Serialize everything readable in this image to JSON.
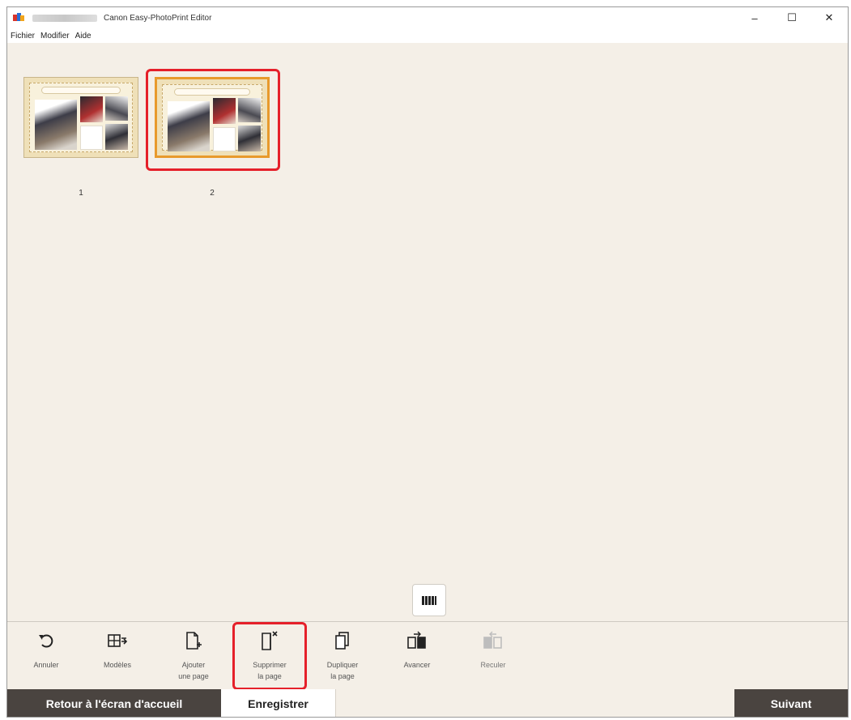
{
  "window": {
    "title": "Canon Easy-PhotoPrint Editor",
    "controls": {
      "minimize": "–",
      "maximize": "☐",
      "close": "✕"
    }
  },
  "menu": [
    {
      "label": "Fichier"
    },
    {
      "label": "Modifier"
    },
    {
      "label": "Aide"
    }
  ],
  "pages": [
    {
      "number": "1",
      "selected": false
    },
    {
      "number": "2",
      "selected": true
    }
  ],
  "toolbar": {
    "undo": {
      "label": "Annuler",
      "icon": "undo-icon"
    },
    "templates": {
      "label": "Modèles",
      "icon": "templates-icon"
    },
    "add_page": {
      "label": "Ajouter\nune page",
      "icon": "add-page-icon"
    },
    "delete_page": {
      "label": "Supprimer\nla page",
      "icon": "delete-page-icon"
    },
    "duplicate_page": {
      "label": "Dupliquer\nla page",
      "icon": "duplicate-page-icon"
    },
    "move_forward": {
      "label": "Avancer",
      "icon": "move-forward-icon"
    },
    "move_back": {
      "label": "Reculer",
      "icon": "move-back-icon"
    }
  },
  "footer": {
    "home_label": "Retour à l'écran d'accueil",
    "save_label": "Enregistrer",
    "next_label": "Suivant"
  },
  "colors": {
    "background": "#f4efe7",
    "highlight": "#e5202a",
    "selected_border": "#e89a2c",
    "dark_button": "#4a4440"
  }
}
